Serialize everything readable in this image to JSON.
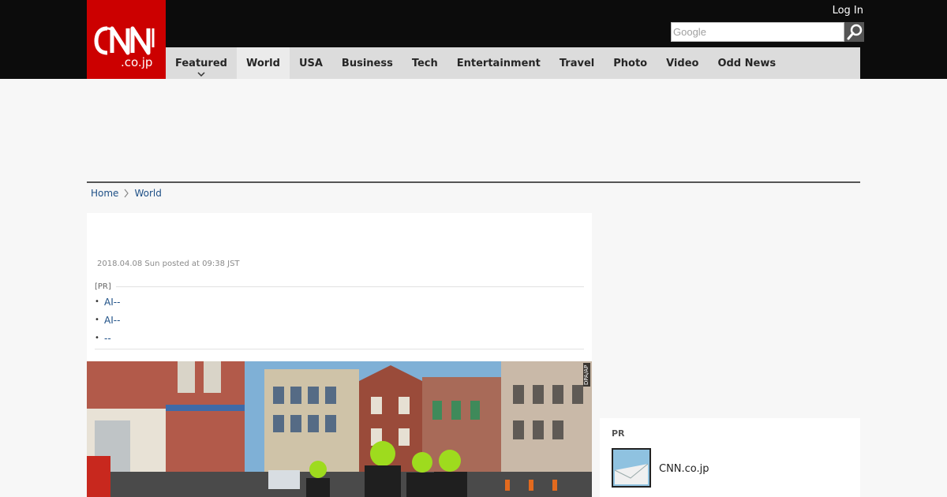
{
  "header": {
    "logo_text": "CNN.co.jp",
    "login_label": "Log In",
    "search_placeholder": "Google",
    "search_icon": "magnifier-icon"
  },
  "nav": {
    "items": [
      {
        "label": "Featured",
        "has_dropdown": true
      },
      {
        "label": "World",
        "active": true
      },
      {
        "label": "USA"
      },
      {
        "label": "Business"
      },
      {
        "label": "Tech"
      },
      {
        "label": "Entertainment"
      },
      {
        "label": "Travel"
      },
      {
        "label": "Photo"
      },
      {
        "label": "Video"
      },
      {
        "label": "Odd News"
      }
    ]
  },
  "breadcrumb": {
    "home": "Home",
    "current": "World"
  },
  "article": {
    "date": "2018.04.08 Sun posted at 09:38 JST",
    "pr_label": "[PR]",
    "pr_links": [
      "AI--",
      "AI--",
      "--"
    ],
    "photo_credit": "DPA/AP"
  },
  "sidebar": {
    "pr_label": "PR",
    "link_text": "CNN.co.jp"
  },
  "colors": {
    "brand_red": "#cc0000",
    "header_black": "#0c0c0c",
    "nav_gray": "#dcdcdc",
    "link_blue": "#1d4f86"
  }
}
